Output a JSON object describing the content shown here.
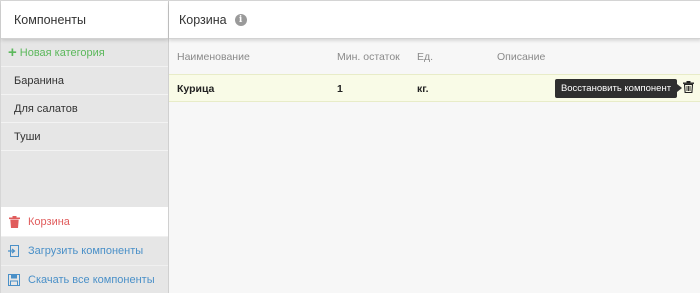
{
  "sidebar": {
    "title": "Компоненты",
    "add_category_label": "Новая категория",
    "categories": [
      "Баранина",
      "Для салатов",
      "Туши"
    ],
    "trash_label": "Корзина",
    "upload_label": "Загрузить компоненты",
    "download_label": "Скачать все компоненты"
  },
  "main": {
    "title": "Корзина",
    "columns": [
      "Наименование",
      "Мин. остаток",
      "Ед.",
      "Описание"
    ],
    "rows": [
      {
        "name": "Курица",
        "min_stock": "1",
        "unit": "кг.",
        "description": ""
      }
    ],
    "tooltip": "Восстановить компонент"
  },
  "colors": {
    "accent_green": "#5cb85c",
    "trash_red": "#e05c5c",
    "link_blue": "#4a90c8",
    "selected_row": "#f9fbe7"
  }
}
